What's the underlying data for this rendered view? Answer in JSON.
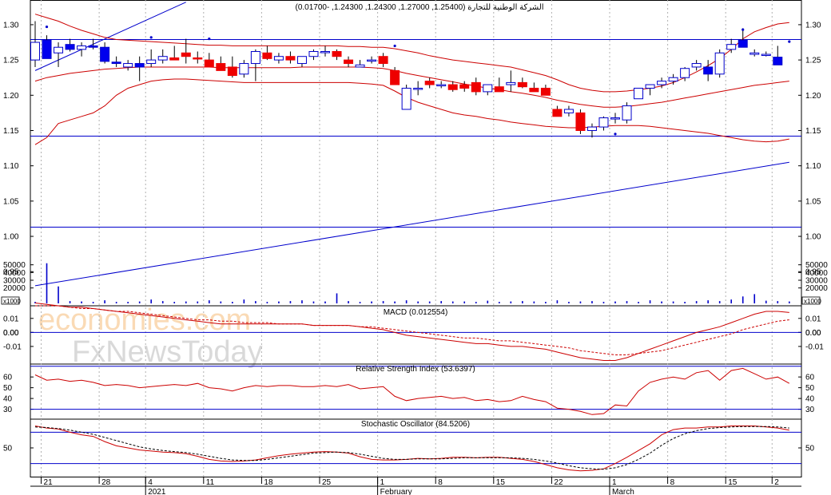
{
  "chart_data": {
    "type": "candlestick",
    "title": "الشركة الوطنية للتجارة (1.25400, 1.27000, 1.24300, 1.24300, -0.01700)",
    "x_labels": [
      {
        "label": "21",
        "i": 1
      },
      {
        "label": "28",
        "i": 6
      },
      {
        "label": "4",
        "i": 10
      },
      {
        "label": "11",
        "i": 15
      },
      {
        "label": "18",
        "i": 20
      },
      {
        "label": "25",
        "i": 25
      },
      {
        "label": "1",
        "i": 30
      },
      {
        "label": "8",
        "i": 35
      },
      {
        "label": "15",
        "i": 40
      },
      {
        "label": "22",
        "i": 45
      },
      {
        "label": "1",
        "i": 50
      },
      {
        "label": "8",
        "i": 55
      },
      {
        "label": "15",
        "i": 60
      },
      {
        "label": "2",
        "i": 64
      }
    ],
    "month_labels": [
      {
        "label": "2021",
        "i": 10
      },
      {
        "label": "February",
        "i": 30
      },
      {
        "label": "March",
        "i": 50
      }
    ],
    "price": {
      "ylim": [
        0.905,
        1.335
      ],
      "yticks": [
        "1.30",
        "1.25",
        "1.20",
        "1.15",
        "1.10",
        "1.05",
        "1.00",
        "0.95"
      ],
      "candles": [
        {
          "o": 1.25,
          "h": 1.305,
          "l": 1.24,
          "c": 1.275
        },
        {
          "o": 1.278,
          "h": 1.285,
          "l": 1.255,
          "c": 1.252
        },
        {
          "o": 1.26,
          "h": 1.275,
          "l": 1.24,
          "c": 1.268
        },
        {
          "o": 1.272,
          "h": 1.28,
          "l": 1.262,
          "c": 1.265
        },
        {
          "o": 1.265,
          "h": 1.275,
          "l": 1.255,
          "c": 1.27
        },
        {
          "o": 1.27,
          "h": 1.28,
          "l": 1.265,
          "c": 1.268
        },
        {
          "o": 1.268,
          "h": 1.275,
          "l": 1.245,
          "c": 1.248
        },
        {
          "o": 1.247,
          "h": 1.255,
          "l": 1.24,
          "c": 1.245
        },
        {
          "o": 1.24,
          "h": 1.25,
          "l": 1.235,
          "c": 1.245
        },
        {
          "o": 1.245,
          "h": 1.255,
          "l": 1.22,
          "c": 1.24
        },
        {
          "o": 1.245,
          "h": 1.265,
          "l": 1.24,
          "c": 1.25
        },
        {
          "o": 1.25,
          "h": 1.265,
          "l": 1.245,
          "c": 1.255
        },
        {
          "o": 1.253,
          "h": 1.27,
          "l": 1.25,
          "c": 1.25
        },
        {
          "o": 1.26,
          "h": 1.28,
          "l": 1.245,
          "c": 1.255
        },
        {
          "o": 1.253,
          "h": 1.262,
          "l": 1.245,
          "c": 1.252
        },
        {
          "o": 1.25,
          "h": 1.26,
          "l": 1.24,
          "c": 1.24
        },
        {
          "o": 1.245,
          "h": 1.255,
          "l": 1.235,
          "c": 1.235
        },
        {
          "o": 1.24,
          "h": 1.255,
          "l": 1.225,
          "c": 1.228
        },
        {
          "o": 1.23,
          "h": 1.25,
          "l": 1.225,
          "c": 1.245
        },
        {
          "o": 1.245,
          "h": 1.265,
          "l": 1.22,
          "c": 1.262
        },
        {
          "o": 1.26,
          "h": 1.27,
          "l": 1.25,
          "c": 1.252
        },
        {
          "o": 1.25,
          "h": 1.26,
          "l": 1.245,
          "c": 1.255
        },
        {
          "o": 1.255,
          "h": 1.262,
          "l": 1.245,
          "c": 1.25
        },
        {
          "o": 1.245,
          "h": 1.255,
          "l": 1.24,
          "c": 1.255
        },
        {
          "o": 1.255,
          "h": 1.265,
          "l": 1.25,
          "c": 1.262
        },
        {
          "o": 1.262,
          "h": 1.27,
          "l": 1.255,
          "c": 1.262
        },
        {
          "o": 1.262,
          "h": 1.265,
          "l": 1.25,
          "c": 1.255
        },
        {
          "o": 1.25,
          "h": 1.255,
          "l": 1.24,
          "c": 1.245
        },
        {
          "o": 1.24,
          "h": 1.25,
          "l": 1.24,
          "c": 1.243
        },
        {
          "o": 1.25,
          "h": 1.255,
          "l": 1.245,
          "c": 1.25
        },
        {
          "o": 1.255,
          "h": 1.26,
          "l": 1.24,
          "c": 1.245
        },
        {
          "o": 1.235,
          "h": 1.24,
          "l": 1.215,
          "c": 1.215
        },
        {
          "o": 1.18,
          "h": 1.215,
          "l": 1.18,
          "c": 1.21
        },
        {
          "o": 1.21,
          "h": 1.22,
          "l": 1.2,
          "c": 1.21
        },
        {
          "o": 1.22,
          "h": 1.225,
          "l": 1.21,
          "c": 1.215
        },
        {
          "o": 1.215,
          "h": 1.22,
          "l": 1.21,
          "c": 1.215
        },
        {
          "o": 1.215,
          "h": 1.22,
          "l": 1.205,
          "c": 1.208
        },
        {
          "o": 1.215,
          "h": 1.22,
          "l": 1.205,
          "c": 1.21
        },
        {
          "o": 1.218,
          "h": 1.225,
          "l": 1.2,
          "c": 1.205
        },
        {
          "o": 1.205,
          "h": 1.215,
          "l": 1.2,
          "c": 1.215
        },
        {
          "o": 1.212,
          "h": 1.225,
          "l": 1.205,
          "c": 1.205
        },
        {
          "o": 1.215,
          "h": 1.235,
          "l": 1.205,
          "c": 1.218
        },
        {
          "o": 1.218,
          "h": 1.225,
          "l": 1.21,
          "c": 1.212
        },
        {
          "o": 1.21,
          "h": 1.218,
          "l": 1.205,
          "c": 1.205
        },
        {
          "o": 1.21,
          "h": 1.215,
          "l": 1.2,
          "c": 1.2
        },
        {
          "o": 1.18,
          "h": 1.185,
          "l": 1.17,
          "c": 1.17
        },
        {
          "o": 1.175,
          "h": 1.185,
          "l": 1.17,
          "c": 1.18
        },
        {
          "o": 1.175,
          "h": 1.18,
          "l": 1.145,
          "c": 1.15
        },
        {
          "o": 1.15,
          "h": 1.16,
          "l": 1.14,
          "c": 1.155
        },
        {
          "o": 1.155,
          "h": 1.17,
          "l": 1.15,
          "c": 1.168
        },
        {
          "o": 1.168,
          "h": 1.175,
          "l": 1.16,
          "c": 1.168
        },
        {
          "o": 1.165,
          "h": 1.19,
          "l": 1.16,
          "c": 1.185
        },
        {
          "o": 1.195,
          "h": 1.21,
          "l": 1.195,
          "c": 1.21
        },
        {
          "o": 1.21,
          "h": 1.215,
          "l": 1.2,
          "c": 1.215
        },
        {
          "o": 1.215,
          "h": 1.225,
          "l": 1.21,
          "c": 1.22
        },
        {
          "o": 1.22,
          "h": 1.23,
          "l": 1.215,
          "c": 1.225
        },
        {
          "o": 1.225,
          "h": 1.24,
          "l": 1.22,
          "c": 1.238
        },
        {
          "o": 1.24,
          "h": 1.25,
          "l": 1.235,
          "c": 1.245
        },
        {
          "o": 1.24,
          "h": 1.25,
          "l": 1.22,
          "c": 1.23
        },
        {
          "o": 1.23,
          "h": 1.265,
          "l": 1.225,
          "c": 1.26
        },
        {
          "o": 1.265,
          "h": 1.28,
          "l": 1.26,
          "c": 1.272
        },
        {
          "o": 1.278,
          "h": 1.295,
          "l": 1.27,
          "c": 1.268
        },
        {
          "o": 1.258,
          "h": 1.265,
          "l": 1.255,
          "c": 1.26
        },
        {
          "o": 1.258,
          "h": 1.262,
          "l": 1.255,
          "c": 1.258
        },
        {
          "o": 1.254,
          "h": 1.27,
          "l": 1.243,
          "c": 1.243
        }
      ],
      "upper_band": [
        1.315,
        1.31,
        1.305,
        1.298,
        1.292,
        1.287,
        1.282,
        1.279,
        1.278,
        1.277,
        1.276,
        1.275,
        1.274,
        1.273,
        1.272,
        1.271,
        1.271,
        1.27,
        1.27,
        1.27,
        1.27,
        1.27,
        1.27,
        1.27,
        1.27,
        1.27,
        1.27,
        1.269,
        1.269,
        1.268,
        1.268,
        1.266,
        1.263,
        1.26,
        1.256,
        1.253,
        1.25,
        1.248,
        1.246,
        1.244,
        1.242,
        1.24,
        1.236,
        1.232,
        1.228,
        1.222,
        1.215,
        1.21,
        1.207,
        1.205,
        1.205,
        1.206,
        1.208,
        1.21,
        1.213,
        1.218,
        1.225,
        1.233,
        1.242,
        1.252,
        1.265,
        1.28,
        1.29,
        1.296,
        1.301,
        1.303
      ],
      "mid_band": [
        1.22,
        1.225,
        1.228,
        1.231,
        1.233,
        1.235,
        1.237,
        1.238,
        1.239,
        1.24,
        1.24,
        1.24,
        1.24,
        1.24,
        1.24,
        1.24,
        1.239,
        1.239,
        1.239,
        1.239,
        1.239,
        1.239,
        1.239,
        1.24,
        1.24,
        1.24,
        1.24,
        1.24,
        1.24,
        1.239,
        1.238,
        1.235,
        1.231,
        1.228,
        1.225,
        1.222,
        1.219,
        1.216,
        1.213,
        1.21,
        1.208,
        1.205,
        1.203,
        1.2,
        1.197,
        1.193,
        1.19,
        1.187,
        1.185,
        1.183,
        1.183,
        1.184,
        1.186,
        1.188,
        1.19,
        1.193,
        1.196,
        1.199,
        1.202,
        1.205,
        1.208,
        1.211,
        1.214,
        1.216,
        1.218,
        1.22
      ],
      "lower_band": [
        1.13,
        1.14,
        1.16,
        1.165,
        1.17,
        1.175,
        1.185,
        1.2,
        1.21,
        1.215,
        1.22,
        1.222,
        1.223,
        1.223,
        1.222,
        1.221,
        1.22,
        1.219,
        1.218,
        1.218,
        1.218,
        1.218,
        1.218,
        1.218,
        1.218,
        1.218,
        1.218,
        1.218,
        1.217,
        1.216,
        1.214,
        1.206,
        1.197,
        1.19,
        1.185,
        1.18,
        1.175,
        1.172,
        1.17,
        1.167,
        1.165,
        1.162,
        1.16,
        1.158,
        1.156,
        1.155,
        1.154,
        1.154,
        1.155,
        1.156,
        1.157,
        1.157,
        1.157,
        1.156,
        1.154,
        1.152,
        1.15,
        1.148,
        1.146,
        1.143,
        1.14,
        1.137,
        1.135,
        1.134,
        1.135,
        1.138
      ],
      "dots": [
        {
          "i": 1,
          "v": 1.297
        },
        {
          "i": 10,
          "v": 1.282
        },
        {
          "i": 15,
          "v": 1.28
        },
        {
          "i": 31,
          "v": 1.27
        },
        {
          "i": 50,
          "v": 1.145
        },
        {
          "i": 61,
          "v": 1.293
        },
        {
          "i": 65,
          "v": 1.276
        }
      ],
      "hlines": [
        1.279,
        1.142,
        1.013
      ],
      "trend_steep": [
        {
          "i": 0,
          "v": 1.235
        },
        {
          "i": 13,
          "v": 1.332
        }
      ],
      "trend_long": [
        {
          "i": 0,
          "v": 0.93
        },
        {
          "i": 65,
          "v": 1.105
        }
      ]
    },
    "volume": {
      "ylim": [
        0,
        60000
      ],
      "yticks": [
        "50000",
        "40000",
        "30000",
        "20000"
      ],
      "box_label": "x1000",
      "values": [
        2000,
        52000,
        22000,
        3000,
        2500,
        2000,
        4000,
        2000,
        2000,
        2500,
        5000,
        3000,
        2000,
        2500,
        2500,
        4000,
        2500,
        2000,
        5000,
        3000,
        2000,
        2500,
        3000,
        4000,
        2500,
        2500,
        13000,
        3000,
        2000,
        2500,
        3000,
        2500,
        4000,
        2500,
        2500,
        3000,
        2500,
        2500,
        2000,
        3500,
        2000,
        2500,
        3000,
        2500,
        2000,
        4000,
        2000,
        2500,
        3000,
        2000,
        2500,
        3000,
        2000,
        4000,
        2500,
        2500,
        2000,
        3000,
        4000,
        3000,
        5000,
        9000,
        12000,
        3500,
        3000,
        2500
      ]
    },
    "macd": {
      "label": "MACD (0.012554)",
      "ylim": [
        -0.022,
        0.019
      ],
      "yticks": [
        "0.01",
        "0.00",
        "0.00",
        "-0.01"
      ],
      "macd": [
        0.021,
        0.02,
        0.019,
        0.018,
        0.018,
        0.017,
        0.016,
        0.015,
        0.014,
        0.013,
        0.012,
        0.011,
        0.01,
        0.009,
        0.008,
        0.007,
        0.006,
        0.006,
        0.006,
        0.006,
        0.006,
        0.006,
        0.006,
        0.006,
        0.005,
        0.005,
        0.005,
        0.005,
        0.004,
        0.003,
        0.002,
        0.0,
        -0.002,
        -0.003,
        -0.004,
        -0.005,
        -0.006,
        -0.007,
        -0.008,
        -0.008,
        -0.009,
        -0.01,
        -0.01,
        -0.011,
        -0.012,
        -0.014,
        -0.016,
        -0.018,
        -0.019,
        -0.02,
        -0.02,
        -0.018,
        -0.015,
        -0.012,
        -0.009,
        -0.006,
        -0.003,
        0.0,
        0.002,
        0.004,
        0.007,
        0.01,
        0.013,
        0.015,
        0.015,
        0.0142
      ],
      "signal": [
        0.019,
        0.019,
        0.019,
        0.018,
        0.017,
        0.017,
        0.016,
        0.015,
        0.015,
        0.014,
        0.013,
        0.012,
        0.011,
        0.01,
        0.009,
        0.009,
        0.008,
        0.008,
        0.007,
        0.007,
        0.007,
        0.006,
        0.006,
        0.006,
        0.005,
        0.005,
        0.005,
        0.005,
        0.004,
        0.004,
        0.003,
        0.002,
        0.001,
        0.0,
        -0.001,
        -0.002,
        -0.003,
        -0.004,
        -0.004,
        -0.005,
        -0.006,
        -0.006,
        -0.007,
        -0.008,
        -0.009,
        -0.01,
        -0.011,
        -0.013,
        -0.014,
        -0.015,
        -0.016,
        -0.016,
        -0.015,
        -0.014,
        -0.013,
        -0.011,
        -0.009,
        -0.007,
        -0.005,
        -0.003,
        -0.001,
        0.002,
        0.004,
        0.006,
        0.008,
        0.009
      ],
      "hlines": [
        0.0
      ]
    },
    "rsi": {
      "label": "Relative Strength Index (53.6397)",
      "ylim": [
        23,
        72
      ],
      "yticks": [
        "60",
        "50",
        "40",
        "30"
      ],
      "values": [
        62,
        57,
        58,
        56,
        57,
        55,
        52,
        53,
        52,
        50,
        51,
        52,
        53,
        52,
        54,
        50,
        49,
        47,
        50,
        52,
        51,
        52,
        52,
        51,
        51,
        52,
        51,
        53,
        49,
        50,
        51,
        42,
        38,
        40,
        41,
        42,
        40,
        41,
        38,
        39,
        37,
        38,
        42,
        39,
        37,
        31,
        30,
        28,
        25,
        26,
        34,
        33,
        47,
        55,
        58,
        60,
        58,
        64,
        66,
        57,
        66,
        68,
        63,
        58,
        60,
        54
      ],
      "hlines": [
        70,
        30
      ]
    },
    "stochastic": {
      "label": "Stochastic Oscillator (84.5206)",
      "ylim": [
        -5,
        105
      ],
      "ytick": "50",
      "k": [
        92,
        88,
        86,
        80,
        75,
        72,
        62,
        54,
        50,
        46,
        44,
        42,
        41,
        39,
        34,
        28,
        25,
        24,
        25,
        27,
        31,
        35,
        38,
        40,
        42,
        43,
        42,
        40,
        33,
        28,
        27,
        27,
        28,
        30,
        29,
        30,
        32,
        32,
        31,
        32,
        32,
        30,
        28,
        24,
        18,
        12,
        8,
        6,
        7,
        10,
        20,
        32,
        45,
        58,
        75,
        85,
        88,
        88,
        90,
        90,
        92,
        92,
        92,
        90,
        88,
        84
      ],
      "d": [
        90,
        89,
        87,
        84,
        80,
        76,
        70,
        64,
        58,
        52,
        48,
        45,
        43,
        41,
        38,
        34,
        30,
        27,
        26,
        26,
        28,
        31,
        34,
        37,
        40,
        41,
        42,
        41,
        38,
        34,
        30,
        28,
        28,
        29,
        29,
        29,
        30,
        31,
        31,
        31,
        31,
        31,
        30,
        28,
        25,
        21,
        16,
        12,
        10,
        9,
        12,
        18,
        28,
        40,
        55,
        68,
        77,
        83,
        87,
        89,
        90,
        91,
        91,
        91,
        90,
        88
      ],
      "hlines": [
        80,
        20
      ]
    },
    "watermark": [
      "economies.com",
      "FxNewsToday"
    ]
  }
}
